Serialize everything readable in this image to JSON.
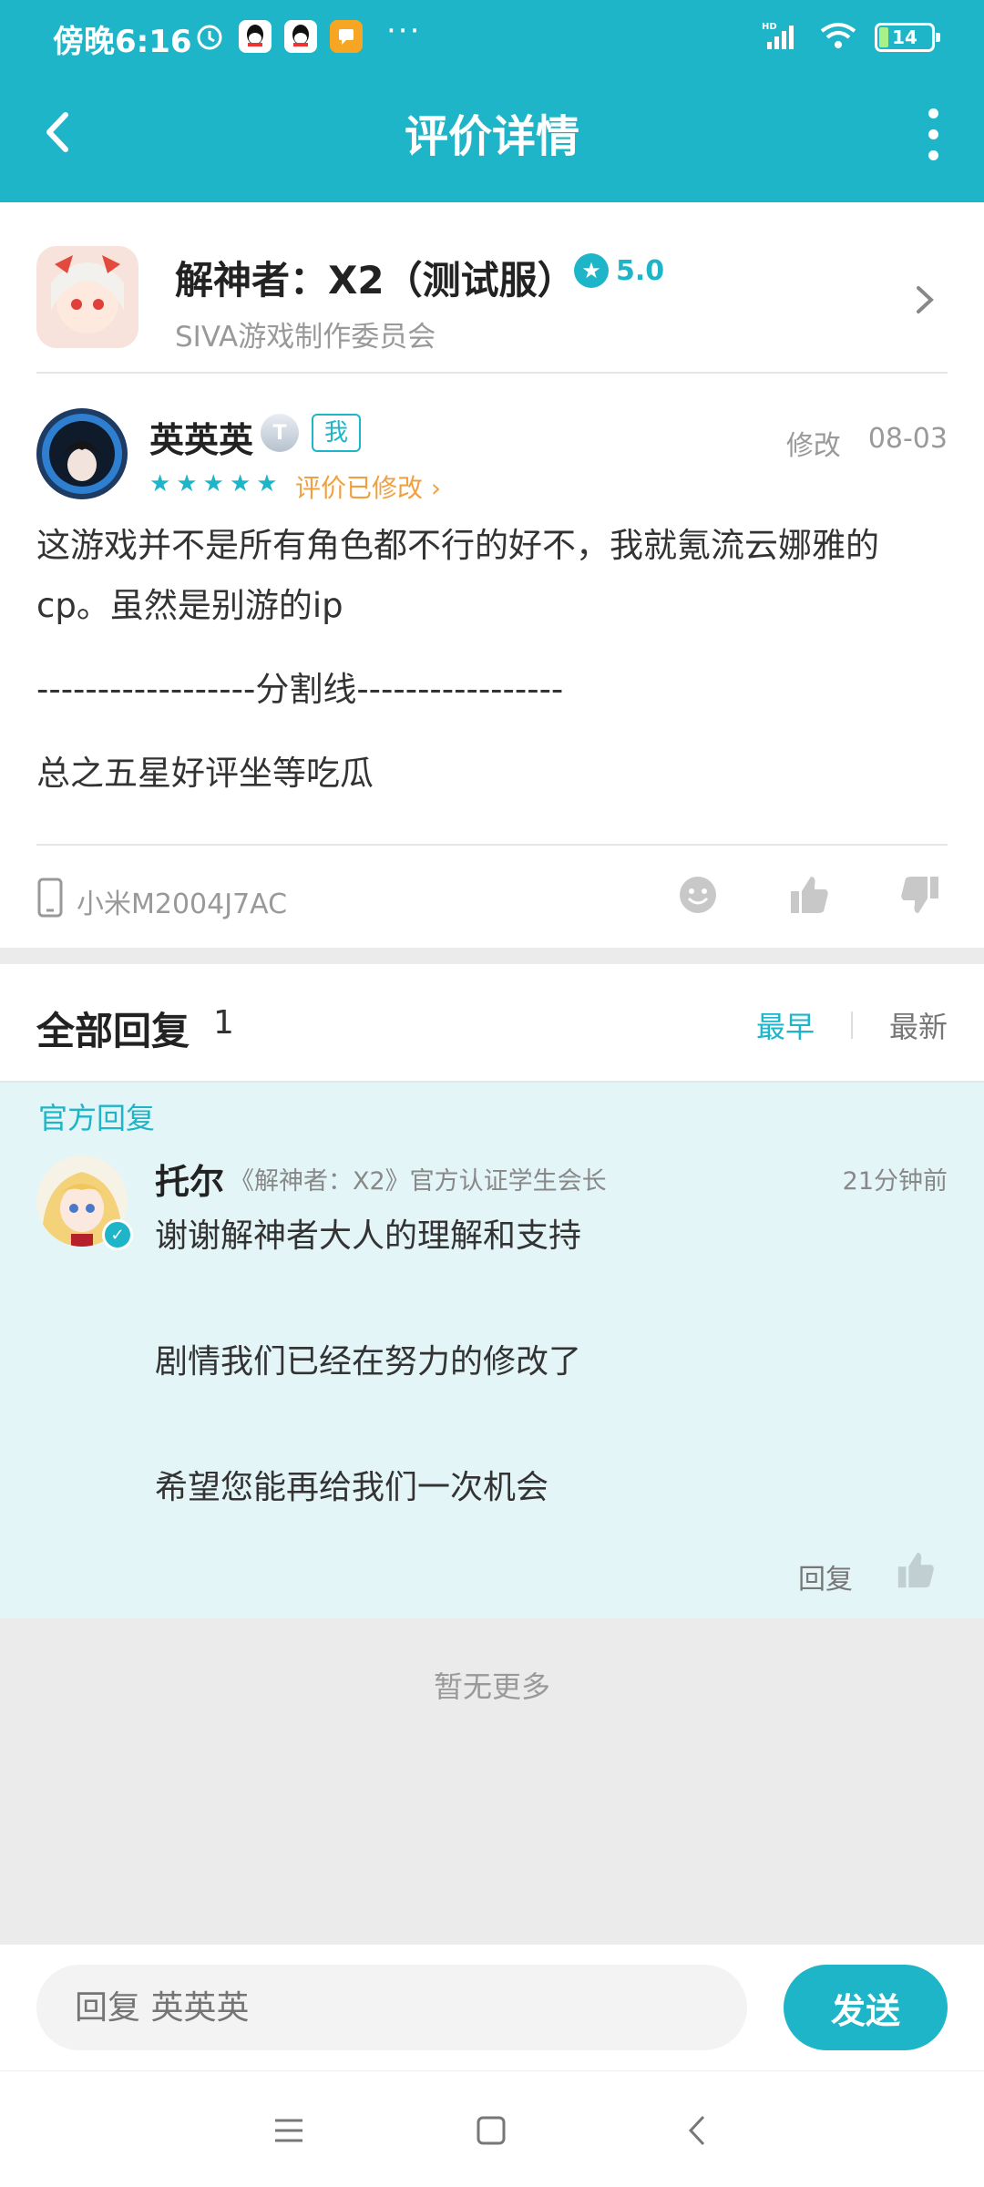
{
  "status_bar": {
    "time": "傍晚6:16",
    "more": "···",
    "network": "HD",
    "battery": "14"
  },
  "nav": {
    "title": "评价详情"
  },
  "app": {
    "name": "解神者：X2（测试服）",
    "rating": "5.0",
    "developer": "SIVA游戏制作委员会"
  },
  "review": {
    "user_name": "英英英",
    "level": "T",
    "me_tag": "我",
    "stars": 5,
    "edited_label": "评价已修改 ›",
    "edit_label": "修改",
    "date": "08-03",
    "paragraphs": [
      "这游戏并不是所有角色都不行的好不，我就氪流云娜雅的cp。虽然是别游的ip",
      "------------------分割线-----------------",
      "总之五星好评坐等吃瓜"
    ],
    "device": "小米M2004J7AC"
  },
  "replies": {
    "title": "全部回复",
    "count": "1",
    "sort_earliest": "最早",
    "sort_latest": "最新",
    "official_label": "官方回复",
    "official": {
      "name": "托尔",
      "title": "《解神者：X2》官方认证学生会长",
      "time": "21分钟前",
      "lines": [
        "谢谢解神者大人的理解和支持",
        "剧情我们已经在努力的修改了",
        "希望您能再给我们一次机会"
      ],
      "reply_label": "回复"
    },
    "no_more": "暂无更多"
  },
  "input": {
    "placeholder": "回复 英英英",
    "send_label": "发送"
  },
  "colors": {
    "accent": "#1eb5c8",
    "orange": "#f0a040",
    "official_bg": "#e4f5f7"
  }
}
